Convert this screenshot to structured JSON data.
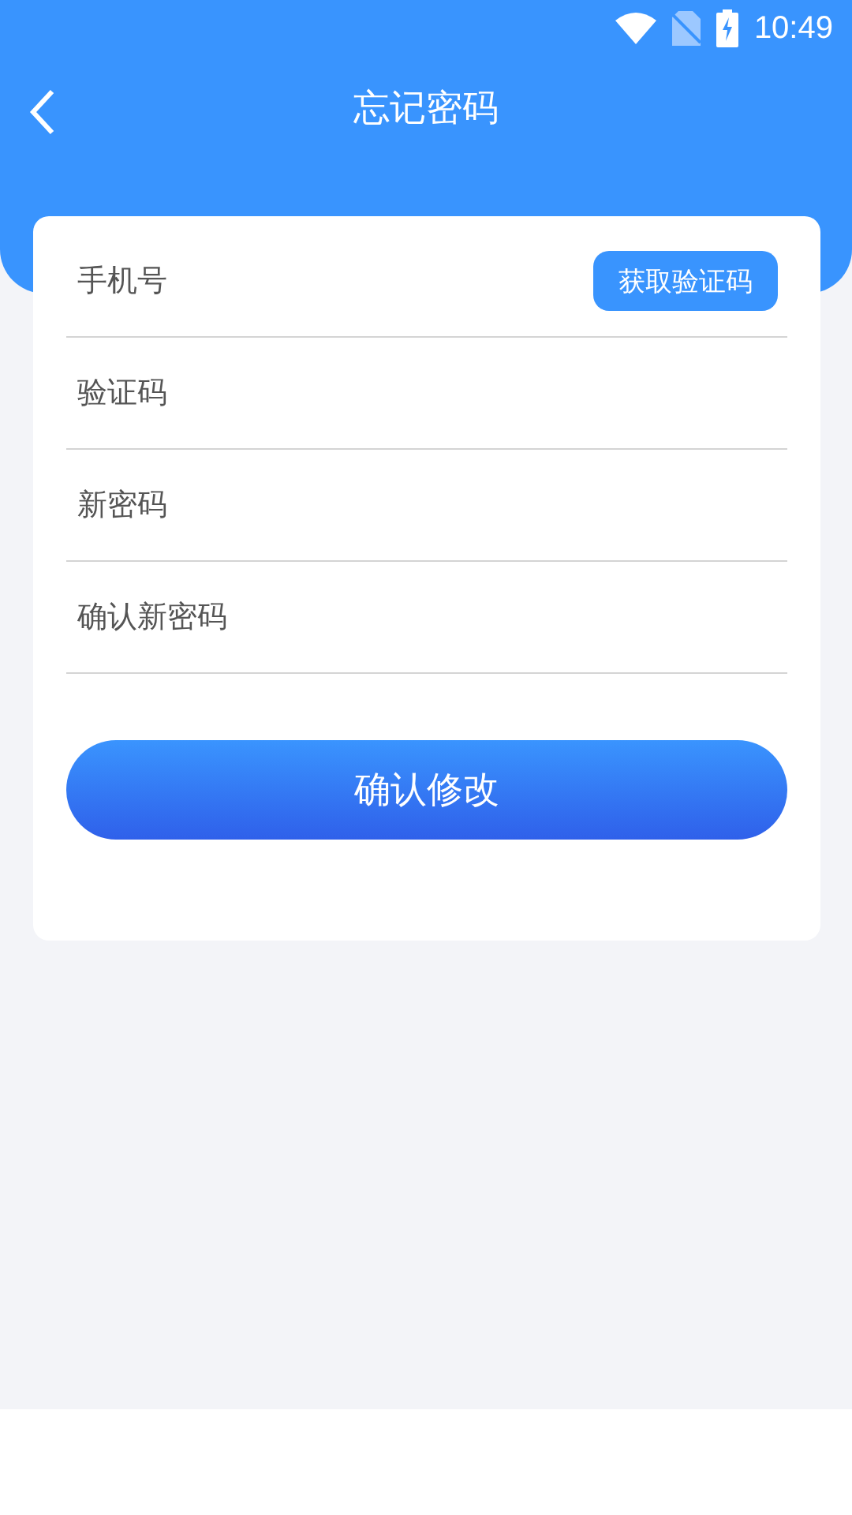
{
  "status_bar": {
    "time": "10:49"
  },
  "header": {
    "title": "忘记密码"
  },
  "fields": [
    {
      "placeholder": "手机号",
      "kind": "code"
    },
    {
      "placeholder": "验证码",
      "kind": "plain"
    },
    {
      "placeholder": "新密码",
      "kind": "plain"
    },
    {
      "placeholder": "确认新密码",
      "kind": "plain"
    }
  ],
  "code_button": "获取验证码",
  "submit_button": "确认修改"
}
